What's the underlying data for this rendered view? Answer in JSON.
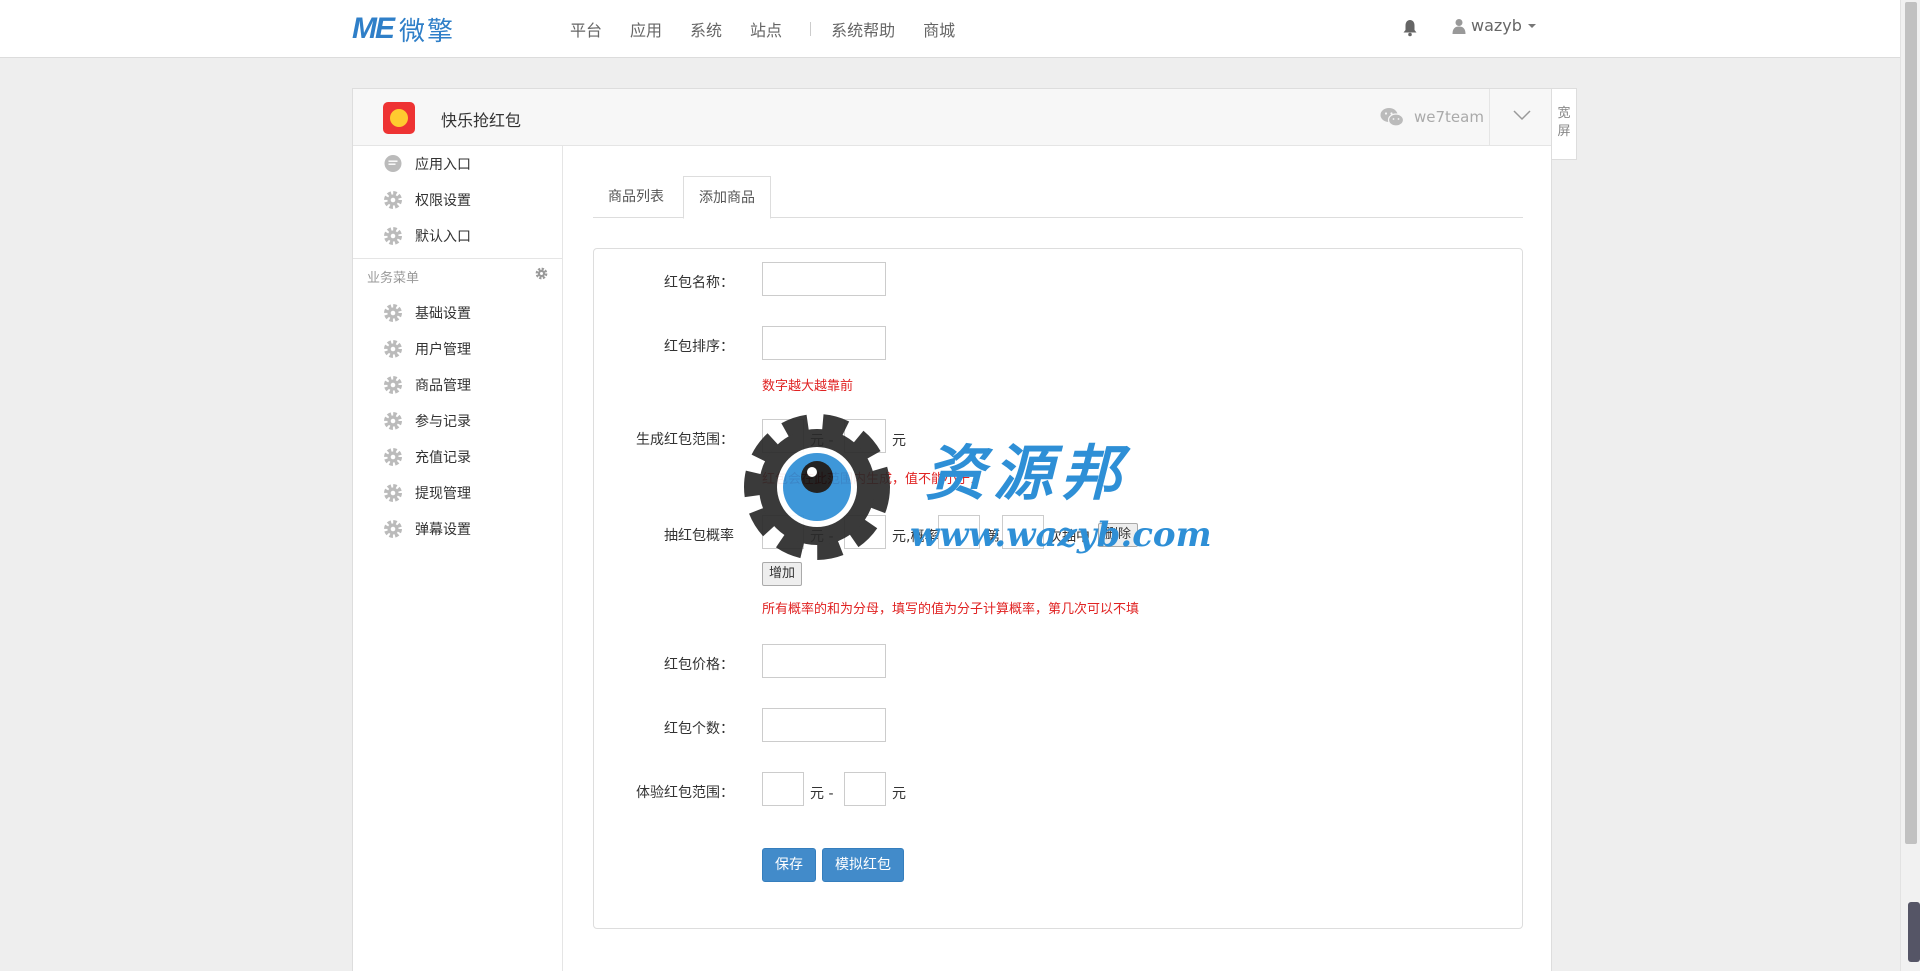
{
  "topnav": {
    "logo_mark": "ME",
    "logo_text": "微擎",
    "items": [
      {
        "label": "平台"
      },
      {
        "label": "应用"
      },
      {
        "label": "系统"
      },
      {
        "label": "站点"
      },
      {
        "label": "系统帮助"
      },
      {
        "label": "商城"
      }
    ],
    "user": "wazyb"
  },
  "panel": {
    "app_title": "快乐抢红包",
    "account": "we7team",
    "widescreen": "宽屏"
  },
  "sidebar": {
    "top_items": [
      {
        "label": "应用入口",
        "icon": "comment-icon"
      },
      {
        "label": "权限设置",
        "icon": "gear-icon"
      },
      {
        "label": "默认入口",
        "icon": "gear-icon"
      }
    ],
    "group_title": "业务菜单",
    "items": [
      {
        "label": "基础设置"
      },
      {
        "label": "用户管理"
      },
      {
        "label": "商品管理"
      },
      {
        "label": "参与记录"
      },
      {
        "label": "充值记录"
      },
      {
        "label": "提现管理"
      },
      {
        "label": "弹幕设置"
      }
    ]
  },
  "tabs": [
    {
      "label": "商品列表",
      "active": false
    },
    {
      "label": "添加商品",
      "active": true
    }
  ],
  "form": {
    "name_label": "红包名称：",
    "sort_label": "红包排序：",
    "sort_hint": "数字越大越靠前",
    "range_label": "生成红包范围：",
    "range_hint": "红包会在此范围内生成，值不能小于1",
    "prob_label": "抽红包概率",
    "prob_sep1": "元 -",
    "prob_sep2": "元,概率",
    "prob_sep3": "第",
    "prob_sep4": "次抽中",
    "delete_label": "删除",
    "add_label": "增加",
    "prob_hint": "所有概率的和为分母，填写的值为分子计算概率，第几次可以不填",
    "price_label": "红包价格：",
    "count_label": "红包个数：",
    "trial_label": "体验红包范围：",
    "yuan_dash": "元 -",
    "yuan": "元",
    "save_label": "保存",
    "simulate_label": "模拟红包"
  },
  "watermark": {
    "cn": "资源邦",
    "url": "www.wazyb.com"
  }
}
